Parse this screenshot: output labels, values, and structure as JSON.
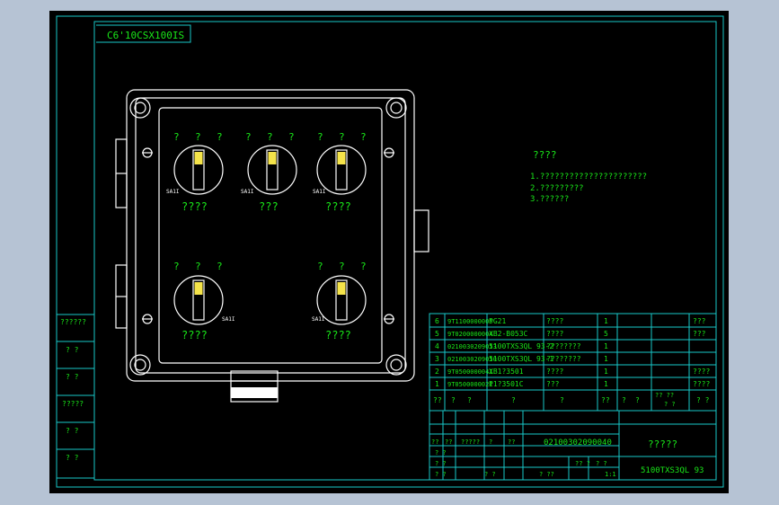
{
  "drawing": {
    "code_tab": "C6'10CSX100IS",
    "knob_row1": {
      "marks": [
        [
          "?",
          "?",
          "?"
        ],
        [
          "?",
          "?",
          "?"
        ],
        [
          "?",
          "?",
          "?"
        ]
      ],
      "tags": [
        "SA1I",
        "SA1I",
        "SA1I"
      ],
      "labels": [
        "????",
        "???",
        "????"
      ]
    },
    "knob_row2": {
      "marks": [
        [
          "?",
          "?",
          "?"
        ],
        [
          "?",
          "?",
          "?"
        ]
      ],
      "tags": [
        "SA1I",
        "SA1I"
      ],
      "labels": [
        "????",
        "????"
      ]
    },
    "notes": {
      "title": "????",
      "lines": [
        "1.??????????????????????",
        "2.?????????",
        "3.??????"
      ]
    },
    "left_strip": [
      "??????",
      "? ?",
      "? ?",
      "?????",
      "? ?",
      "? ?"
    ]
  },
  "bom": {
    "rows": [
      {
        "no": "6",
        "code": "9T1100000005",
        "model": "PG21",
        "name": "????",
        "qty": "1",
        "note": "???"
      },
      {
        "no": "5",
        "code": "9T0200000004",
        "model": "XB2-B053C",
        "name": "????",
        "qty": "5",
        "note": "???"
      },
      {
        "no": "4",
        "code": "02100302090I3",
        "model": "5100TXS3QL 93-2",
        "name": "????????",
        "qty": "1",
        "note": ""
      },
      {
        "no": "3",
        "code": "02100302090I0",
        "model": "5100TXS3QL 93-1",
        "name": "????????",
        "qty": "1",
        "note": ""
      },
      {
        "no": "2",
        "code": "9T0500000041",
        "model": "XB1?3501",
        "name": "????",
        "qty": "1",
        "note": "????"
      },
      {
        "no": "1",
        "code": "9T0500000021",
        "model": "P1?3501C",
        "name": "???",
        "qty": "1",
        "note": "????"
      }
    ],
    "header": [
      "??",
      "?",
      "?",
      "?",
      "?",
      "??",
      "?",
      "?",
      "?? ??",
      "? ?",
      "? ?"
    ]
  },
  "title_block": {
    "drawing_number": "02100302090040",
    "title": "?????",
    "model": "5100TXS3QL 93",
    "sign_cells": [
      "??",
      "??",
      "?????",
      "?",
      "??",
      "? ?",
      "? ?",
      "? ?",
      "? ?"
    ],
    "small_cells": [
      "? ??",
      "?? ?",
      "? ?",
      "1:1"
    ]
  }
}
